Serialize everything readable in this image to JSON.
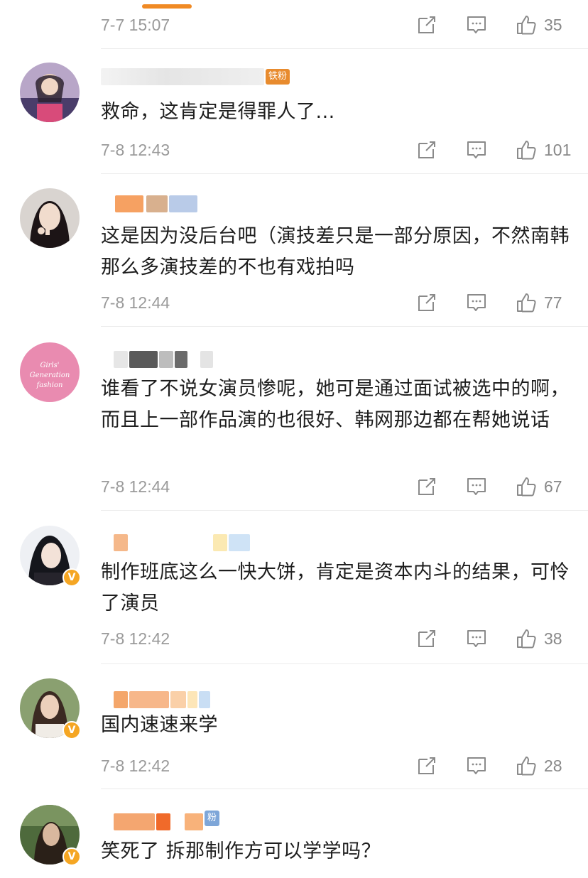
{
  "top_row": {
    "time": "7-7 15:07",
    "likes": "35"
  },
  "comments": [
    {
      "badge": "铁粉",
      "text": "救命，这肯定是得罪人了...",
      "time": "7-8 12:43",
      "likes": "101"
    },
    {
      "badge": "",
      "text": "这是因为没后台吧（演技差只是一部分原因，不然南韩那么多演技差的不也有戏拍吗",
      "time": "7-8 12:44",
      "likes": "77"
    },
    {
      "badge": "",
      "avatar_text": "Girls' Generation fashion",
      "text": "谁看了不说女演员惨呢，她可是通过面试被选中的啊，而且上一部作品演的也很好、韩网那边都在帮她说话",
      "time": "7-8 12:44",
      "likes": "67"
    },
    {
      "badge": "",
      "verified": "V",
      "text": "制作班底这么一快大饼，肯定是资本内斗的结果，可怜了演员",
      "time": "7-8 12:42",
      "likes": "38"
    },
    {
      "badge": "",
      "verified": "V",
      "text": "国内速速来学",
      "time": "7-8 12:42",
      "likes": "28"
    },
    {
      "badge": "粉",
      "verified": "V",
      "text": "笑死了 拆那制作方可以学学吗？",
      "time": "",
      "likes": ""
    }
  ],
  "icons": {
    "share": "share-icon",
    "comment": "comment-icon",
    "like": "thumbs-up-icon"
  },
  "colors": {
    "badge": "#e88b2e",
    "verified": "#f5a623",
    "meta": "#9a9a9a"
  }
}
